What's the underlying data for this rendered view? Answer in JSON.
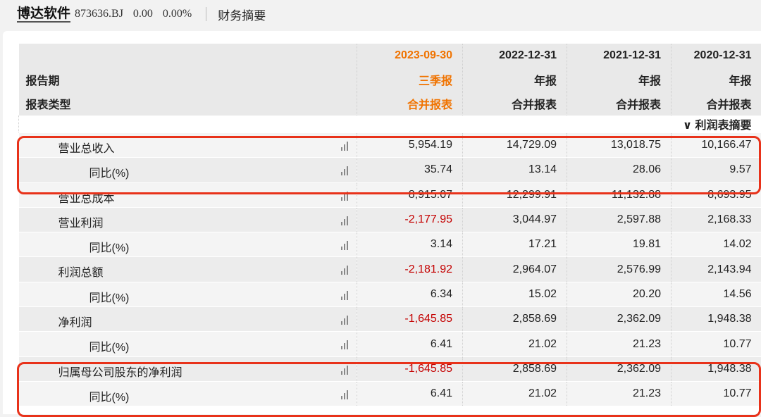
{
  "header": {
    "stock_name": "博达软件",
    "stock_code": "873636.BJ",
    "price": "0.00",
    "change": "0.00%",
    "page_title": "财务摘要"
  },
  "table": {
    "row_labels": {
      "period": "报告期",
      "type": "报表类型"
    },
    "columns": [
      {
        "date": "2023-09-30",
        "period": "三季报",
        "type": "合并报表",
        "accent": true
      },
      {
        "date": "2022-12-31",
        "period": "年报",
        "type": "合并报表"
      },
      {
        "date": "2021-12-31",
        "period": "年报",
        "type": "合并报表"
      },
      {
        "date": "2020-12-31",
        "period": "年报",
        "type": "合并报表"
      }
    ],
    "section_title": "利润表摘要",
    "rows": [
      {
        "label": "营业总收入",
        "level": 1,
        "values": [
          "5,954.19",
          "14,729.09",
          "13,018.75",
          "10,166.47"
        ]
      },
      {
        "label": "同比(%)",
        "level": 2,
        "values": [
          "35.74",
          "13.14",
          "28.06",
          "9.57"
        ]
      },
      {
        "label": "营业总成本",
        "level": 1,
        "values": [
          "8,915.07",
          "12,299.91",
          "11,132.88",
          "8,693.95"
        ]
      },
      {
        "label": "营业利润",
        "level": 1,
        "values": [
          "-2,177.95",
          "3,044.97",
          "2,597.88",
          "2,168.33"
        ]
      },
      {
        "label": "同比(%)",
        "level": 2,
        "values": [
          "3.14",
          "17.21",
          "19.81",
          "14.02"
        ]
      },
      {
        "label": "利润总额",
        "level": 1,
        "values": [
          "-2,181.92",
          "2,964.07",
          "2,576.99",
          "2,143.94"
        ]
      },
      {
        "label": "同比(%)",
        "level": 2,
        "values": [
          "6.34",
          "15.02",
          "20.20",
          "14.56"
        ]
      },
      {
        "label": "净利润",
        "level": 1,
        "values": [
          "-1,645.85",
          "2,858.69",
          "2,362.09",
          "1,948.38"
        ]
      },
      {
        "label": "同比(%)",
        "level": 2,
        "values": [
          "6.41",
          "21.02",
          "21.23",
          "10.77"
        ]
      },
      {
        "label": "归属母公司股东的净利润",
        "level": 1,
        "values": [
          "-1,645.85",
          "2,858.69",
          "2,362.09",
          "1,948.38"
        ]
      },
      {
        "label": "同比(%)",
        "level": 2,
        "values": [
          "6.41",
          "21.02",
          "21.23",
          "10.77"
        ]
      }
    ]
  },
  "colors": {
    "accent": "#f07300",
    "negative": "#c40000",
    "highlight": "#e8321a"
  }
}
